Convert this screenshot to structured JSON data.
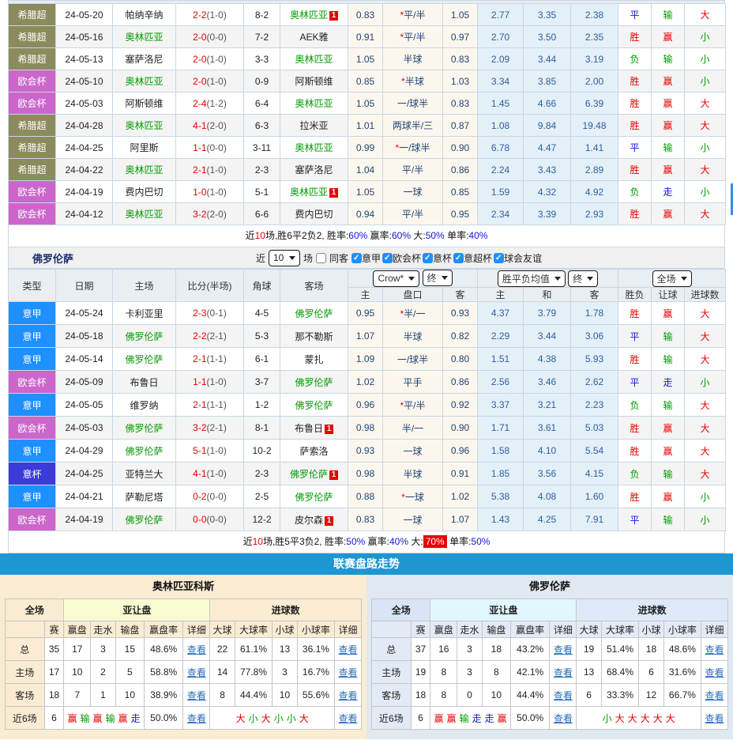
{
  "colors": {
    "win": "#e60000",
    "draw": "#1414d8",
    "lose": "#009900",
    "big": "#e60000",
    "small": "#009900",
    "focus_team": "#009900",
    "banner": "#1e96d2",
    "league_greek": "#8b8b5d",
    "league_uecl": "#cb67cb",
    "league_seriea": "#1e90ff",
    "league_coppa": "#3b3bd9"
  },
  "table1": {
    "rows": [
      {
        "league": "希腊超",
        "date": "24-05-20",
        "home": "帕纳辛纳",
        "home_focus": false,
        "home_card": "",
        "score": "2-2",
        "half": "(1-0)",
        "corners": "8-2",
        "away": "奥林匹亚",
        "away_focus": true,
        "away_card": "1",
        "asia_home": "0.83",
        "handicap": "*平/半",
        "asia_away": "1.05",
        "euro_home": "2.77",
        "euro_draw": "3.35",
        "euro_away": "2.38",
        "result": "平",
        "handicap_result": "输",
        "goals_result": "大"
      },
      {
        "league": "希腊超",
        "date": "24-05-16",
        "home": "奥林匹亚",
        "home_focus": true,
        "home_card": "",
        "score": "2-0",
        "half": "(0-0)",
        "corners": "7-2",
        "away": "AEK雅",
        "away_focus": false,
        "away_card": "",
        "asia_home": "0.91",
        "handicap": "*平/半",
        "asia_away": "0.97",
        "euro_home": "2.70",
        "euro_draw": "3.50",
        "euro_away": "2.35",
        "result": "胜",
        "handicap_result": "赢",
        "goals_result": "小"
      },
      {
        "league": "希腊超",
        "date": "24-05-13",
        "home": "塞萨洛尼",
        "home_focus": false,
        "home_card": "",
        "score": "2-0",
        "half": "(1-0)",
        "corners": "3-3",
        "away": "奥林匹亚",
        "away_focus": true,
        "away_card": "",
        "asia_home": "1.05",
        "handicap": "半球",
        "asia_away": "0.83",
        "euro_home": "2.09",
        "euro_draw": "3.44",
        "euro_away": "3.19",
        "result": "负",
        "handicap_result": "输",
        "goals_result": "小"
      },
      {
        "league": "欧会杯",
        "date": "24-05-10",
        "home": "奥林匹亚",
        "home_focus": true,
        "home_card": "",
        "score": "2-0",
        "half": "(1-0)",
        "corners": "0-9",
        "away": "阿斯顿维",
        "away_focus": false,
        "away_card": "",
        "asia_home": "0.85",
        "handicap": "*半球",
        "asia_away": "1.03",
        "euro_home": "3.34",
        "euro_draw": "3.85",
        "euro_away": "2.00",
        "result": "胜",
        "handicap_result": "赢",
        "goals_result": "小"
      },
      {
        "league": "欧会杯",
        "date": "24-05-03",
        "home": "阿斯顿维",
        "home_focus": false,
        "home_card": "",
        "score": "2-4",
        "half": "(1-2)",
        "corners": "6-4",
        "away": "奥林匹亚",
        "away_focus": true,
        "away_card": "",
        "asia_home": "1.05",
        "handicap": "一/球半",
        "asia_away": "0.83",
        "euro_home": "1.45",
        "euro_draw": "4.66",
        "euro_away": "6.39",
        "result": "胜",
        "handicap_result": "赢",
        "goals_result": "大"
      },
      {
        "league": "希腊超",
        "date": "24-04-28",
        "home": "奥林匹亚",
        "home_focus": true,
        "home_card": "",
        "score": "4-1",
        "half": "(2-0)",
        "corners": "6-3",
        "away": "拉米亚",
        "away_focus": false,
        "away_card": "",
        "asia_home": "1.01",
        "handicap": "两球半/三",
        "asia_away": "0.87",
        "euro_home": "1.08",
        "euro_draw": "9.84",
        "euro_away": "19.48",
        "result": "胜",
        "handicap_result": "赢",
        "goals_result": "大"
      },
      {
        "league": "希腊超",
        "date": "24-04-25",
        "home": "阿里斯",
        "home_focus": false,
        "home_card": "",
        "score": "1-1",
        "half": "(0-0)",
        "corners": "3-11",
        "away": "奥林匹亚",
        "away_focus": true,
        "away_card": "",
        "asia_home": "0.99",
        "handicap": "*一/球半",
        "asia_away": "0.90",
        "euro_home": "6.78",
        "euro_draw": "4.47",
        "euro_away": "1.41",
        "result": "平",
        "handicap_result": "输",
        "goals_result": "小"
      },
      {
        "league": "希腊超",
        "date": "24-04-22",
        "home": "奥林匹亚",
        "home_focus": true,
        "home_card": "",
        "score": "2-1",
        "half": "(1-0)",
        "corners": "2-3",
        "away": "塞萨洛尼",
        "away_focus": false,
        "away_card": "",
        "asia_home": "1.04",
        "handicap": "平/半",
        "asia_away": "0.86",
        "euro_home": "2.24",
        "euro_draw": "3.43",
        "euro_away": "2.89",
        "result": "胜",
        "handicap_result": "赢",
        "goals_result": "大"
      },
      {
        "league": "欧会杯",
        "date": "24-04-19",
        "home": "费内巴切",
        "home_focus": false,
        "home_card": "",
        "score": "1-0",
        "half": "(1-0)",
        "corners": "5-1",
        "away": "奥林匹亚",
        "away_focus": true,
        "away_card": "1",
        "asia_home": "1.05",
        "handicap": "一球",
        "asia_away": "0.85",
        "euro_home": "1.59",
        "euro_draw": "4.32",
        "euro_away": "4.92",
        "result": "负",
        "handicap_result": "走",
        "goals_result": "小"
      },
      {
        "league": "欧会杯",
        "date": "24-04-12",
        "home": "奥林匹亚",
        "home_focus": true,
        "home_card": "",
        "score": "3-2",
        "half": "(2-0)",
        "corners": "6-6",
        "away": "费内巴切",
        "away_focus": false,
        "away_card": "",
        "asia_home": "0.94",
        "handicap": "平/半",
        "asia_away": "0.95",
        "euro_home": "2.34",
        "euro_draw": "3.39",
        "euro_away": "2.93",
        "result": "胜",
        "handicap_result": "赢",
        "goals_result": "大"
      }
    ]
  },
  "summary1": {
    "segments": [
      {
        "t": "近",
        "s": ""
      },
      {
        "t": "10",
        "s": "red"
      },
      {
        "t": "场,胜6平2负2, 胜率:",
        "s": ""
      },
      {
        "t": "60%",
        "s": "blue"
      },
      {
        "t": " 赢率:",
        "s": ""
      },
      {
        "t": "60%",
        "s": "blue"
      },
      {
        "t": " 大:",
        "s": ""
      },
      {
        "t": "50%",
        "s": "blue"
      },
      {
        "t": " 单率:",
        "s": ""
      },
      {
        "t": "40%",
        "s": "blue"
      }
    ]
  },
  "section2": {
    "title": "佛罗伦萨",
    "near_label": "近",
    "games_value": "10",
    "games_label": "场",
    "same_away_label": "同客",
    "leagues": [
      {
        "label": "意甲",
        "checked": true
      },
      {
        "label": "欧会杯",
        "checked": true
      },
      {
        "label": "意杯",
        "checked": true
      },
      {
        "label": "意超杯",
        "checked": true
      },
      {
        "label": "球会友谊",
        "checked": true
      }
    ]
  },
  "table2": {
    "header": {
      "cols": [
        "类型",
        "日期",
        "主场",
        "比分(半场)",
        "角球",
        "客场"
      ],
      "odds_source": "Crow*",
      "odds_state": "终",
      "europe_source": "胜平负均值",
      "europe_state": "终",
      "scope": "全场",
      "sub": [
        "主",
        "盘口",
        "客",
        "主",
        "和",
        "客",
        "胜负",
        "让球",
        "进球数"
      ]
    },
    "rows": [
      {
        "league": "意甲",
        "date": "24-05-24",
        "home": "卡利亚里",
        "home_focus": false,
        "home_card": "",
        "score": "2-3",
        "half": "(0-1)",
        "corners": "4-5",
        "away": "佛罗伦萨",
        "away_focus": true,
        "away_card": "",
        "asia_home": "0.95",
        "handicap": "*半/一",
        "asia_away": "0.93",
        "euro_home": "4.37",
        "euro_draw": "3.79",
        "euro_away": "1.78",
        "result": "胜",
        "handicap_result": "赢",
        "goals_result": "大"
      },
      {
        "league": "意甲",
        "date": "24-05-18",
        "home": "佛罗伦萨",
        "home_focus": true,
        "home_card": "",
        "score": "2-2",
        "half": "(2-1)",
        "corners": "5-3",
        "away": "那不勒斯",
        "away_focus": false,
        "away_card": "",
        "asia_home": "1.07",
        "handicap": "半球",
        "asia_away": "0.82",
        "euro_home": "2.29",
        "euro_draw": "3.44",
        "euro_away": "3.06",
        "result": "平",
        "handicap_result": "输",
        "goals_result": "大"
      },
      {
        "league": "意甲",
        "date": "24-05-14",
        "home": "佛罗伦萨",
        "home_focus": true,
        "home_card": "",
        "score": "2-1",
        "half": "(1-1)",
        "corners": "6-1",
        "away": "蒙扎",
        "away_focus": false,
        "away_card": "",
        "asia_home": "1.09",
        "handicap": "一/球半",
        "asia_away": "0.80",
        "euro_home": "1.51",
        "euro_draw": "4.38",
        "euro_away": "5.93",
        "result": "胜",
        "handicap_result": "输",
        "goals_result": "大"
      },
      {
        "league": "欧会杯",
        "date": "24-05-09",
        "home": "布鲁日",
        "home_focus": false,
        "home_card": "",
        "score": "1-1",
        "half": "(1-0)",
        "corners": "3-7",
        "away": "佛罗伦萨",
        "away_focus": true,
        "away_card": "",
        "asia_home": "1.02",
        "handicap": "平手",
        "asia_away": "0.86",
        "euro_home": "2.56",
        "euro_draw": "3.46",
        "euro_away": "2.62",
        "result": "平",
        "handicap_result": "走",
        "goals_result": "小"
      },
      {
        "league": "意甲",
        "date": "24-05-05",
        "home": "维罗纳",
        "home_focus": false,
        "home_card": "",
        "score": "2-1",
        "half": "(1-1)",
        "corners": "1-2",
        "away": "佛罗伦萨",
        "away_focus": true,
        "away_card": "",
        "asia_home": "0.96",
        "handicap": "*平/半",
        "asia_away": "0.92",
        "euro_home": "3.37",
        "euro_draw": "3.21",
        "euro_away": "2.23",
        "result": "负",
        "handicap_result": "输",
        "goals_result": "大"
      },
      {
        "league": "欧会杯",
        "date": "24-05-03",
        "home": "佛罗伦萨",
        "home_focus": true,
        "home_card": "",
        "score": "3-2",
        "half": "(2-1)",
        "corners": "8-1",
        "away": "布鲁日",
        "away_focus": false,
        "away_card": "1",
        "asia_home": "0.98",
        "handicap": "半/一",
        "asia_away": "0.90",
        "euro_home": "1.71",
        "euro_draw": "3.61",
        "euro_away": "5.03",
        "result": "胜",
        "handicap_result": "赢",
        "goals_result": "大"
      },
      {
        "league": "意甲",
        "date": "24-04-29",
        "home": "佛罗伦萨",
        "home_focus": true,
        "home_card": "",
        "score": "5-1",
        "half": "(1-0)",
        "corners": "10-2",
        "away": "萨索洛",
        "away_focus": false,
        "away_card": "",
        "asia_home": "0.93",
        "handicap": "一球",
        "asia_away": "0.96",
        "euro_home": "1.58",
        "euro_draw": "4.10",
        "euro_away": "5.54",
        "result": "胜",
        "handicap_result": "赢",
        "goals_result": "大"
      },
      {
        "league": "意杯",
        "date": "24-04-25",
        "home": "亚特兰大",
        "home_focus": false,
        "home_card": "",
        "score": "4-1",
        "half": "(1-0)",
        "corners": "2-3",
        "away": "佛罗伦萨",
        "away_focus": true,
        "away_card": "1",
        "asia_home": "0.98",
        "handicap": "半球",
        "asia_away": "0.91",
        "euro_home": "1.85",
        "euro_draw": "3.56",
        "euro_away": "4.15",
        "result": "负",
        "handicap_result": "输",
        "goals_result": "大"
      },
      {
        "league": "意甲",
        "date": "24-04-21",
        "home": "萨勒尼塔",
        "home_focus": false,
        "home_card": "",
        "score": "0-2",
        "half": "(0-0)",
        "corners": "2-5",
        "away": "佛罗伦萨",
        "away_focus": true,
        "away_card": "",
        "asia_home": "0.88",
        "handicap": "*一球",
        "asia_away": "1.02",
        "euro_home": "5.38",
        "euro_draw": "4.08",
        "euro_away": "1.60",
        "result": "胜",
        "handicap_result": "赢",
        "goals_result": "小"
      },
      {
        "league": "欧会杯",
        "date": "24-04-19",
        "home": "佛罗伦萨",
        "home_focus": true,
        "home_card": "",
        "score": "0-0",
        "half": "(0-0)",
        "corners": "12-2",
        "away": "皮尔森",
        "away_focus": false,
        "away_card": "1",
        "asia_home": "0.83",
        "handicap": "一球",
        "asia_away": "1.07",
        "euro_home": "1.43",
        "euro_draw": "4.25",
        "euro_away": "7.91",
        "result": "平",
        "handicap_result": "输",
        "goals_result": "小"
      }
    ]
  },
  "summary2": {
    "segments": [
      {
        "t": "近",
        "s": ""
      },
      {
        "t": "10",
        "s": "red"
      },
      {
        "t": "场,胜5平3负2, 胜率:",
        "s": ""
      },
      {
        "t": "50%",
        "s": "blue"
      },
      {
        "t": " 赢率:",
        "s": ""
      },
      {
        "t": "40%",
        "s": "blue"
      },
      {
        "t": " 大:",
        "s": ""
      },
      {
        "t": "70%",
        "s": "hl"
      },
      {
        "t": " 单率:",
        "s": ""
      },
      {
        "t": "50%",
        "s": "blue"
      }
    ]
  },
  "trend": {
    "banner": "联赛盘路走势",
    "left": {
      "team": "奥林匹亚科斯",
      "scope_header": "全场",
      "asia_header": "亚让盘",
      "goals_header": "进球数",
      "cols": [
        "",
        "赛",
        "赢盘",
        "走水",
        "输盘",
        "赢盘率",
        "详细",
        "大球",
        "大球率",
        "小球",
        "小球率",
        "详细"
      ],
      "rows": [
        {
          "label": "总",
          "games": "35",
          "win": "17",
          "push": "3",
          "lose": "15",
          "win_rate": "48.6%",
          "detail": "查看",
          "over": "22",
          "over_rate": "61.1%",
          "under": "13",
          "under_rate": "36.1%",
          "detail2": "查看"
        },
        {
          "label": "主场",
          "games": "17",
          "win": "10",
          "push": "2",
          "lose": "5",
          "win_rate": "58.8%",
          "detail": "查看",
          "over": "14",
          "over_rate": "77.8%",
          "under": "3",
          "under_rate": "16.7%",
          "detail2": "查看"
        },
        {
          "label": "客场",
          "games": "18",
          "win": "7",
          "push": "1",
          "lose": "10",
          "win_rate": "38.9%",
          "detail": "查看",
          "over": "8",
          "over_rate": "44.4%",
          "under": "10",
          "under_rate": "55.6%",
          "detail2": "查看"
        }
      ],
      "recent": {
        "label": "近6场",
        "games": "6",
        "handicap_seq": [
          "赢",
          "输",
          "赢",
          "输",
          "赢",
          "走"
        ],
        "win_rate": "50.0%",
        "detail": "查看",
        "goals_seq": [
          "大",
          "小",
          "大",
          "小",
          "小",
          "大"
        ],
        "detail2": "查看"
      }
    },
    "right": {
      "team": "佛罗伦萨",
      "scope_header": "全场",
      "asia_header": "亚让盘",
      "goals_header": "进球数",
      "cols": [
        "",
        "赛",
        "赢盘",
        "走水",
        "输盘",
        "赢盘率",
        "详细",
        "大球",
        "大球率",
        "小球",
        "小球率",
        "详细"
      ],
      "rows": [
        {
          "label": "总",
          "games": "37",
          "win": "16",
          "push": "3",
          "lose": "18",
          "win_rate": "43.2%",
          "detail": "查看",
          "over": "19",
          "over_rate": "51.4%",
          "under": "18",
          "under_rate": "48.6%",
          "detail2": "查看"
        },
        {
          "label": "主场",
          "games": "19",
          "win": "8",
          "push": "3",
          "lose": "8",
          "win_rate": "42.1%",
          "detail": "查看",
          "over": "13",
          "over_rate": "68.4%",
          "under": "6",
          "under_rate": "31.6%",
          "detail2": "查看"
        },
        {
          "label": "客场",
          "games": "18",
          "win": "8",
          "push": "0",
          "lose": "10",
          "win_rate": "44.4%",
          "detail": "查看",
          "over": "6",
          "over_rate": "33.3%",
          "under": "12",
          "under_rate": "66.7%",
          "detail2": "查看"
        }
      ],
      "recent": {
        "label": "近6场",
        "games": "6",
        "handicap_seq": [
          "赢",
          "赢",
          "输",
          "走",
          "走",
          "赢"
        ],
        "win_rate": "50.0%",
        "detail": "查看",
        "goals_seq": [
          "小",
          "大",
          "大",
          "大",
          "大",
          "大"
        ],
        "detail2": "查看"
      }
    }
  }
}
